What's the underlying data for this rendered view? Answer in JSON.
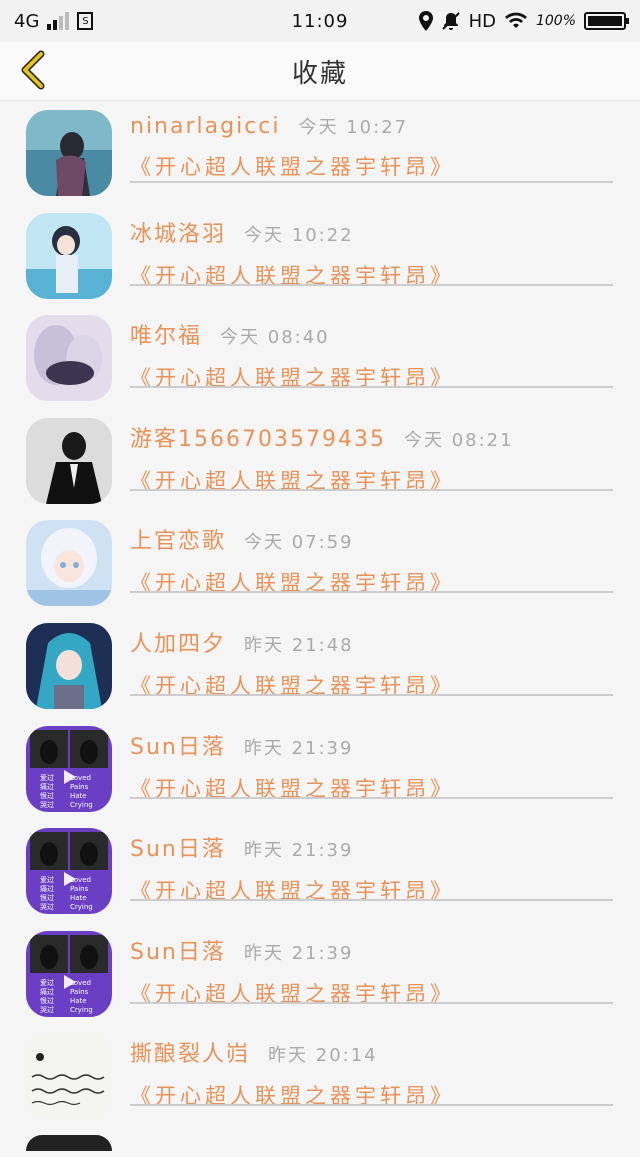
{
  "statusbar": {
    "network": "4G",
    "time": "11:09",
    "hd": "HD",
    "battery_pct": "100%"
  },
  "header": {
    "title": "收藏",
    "back_icon": "chevron-left-icon"
  },
  "colors": {
    "accent": "#e89258",
    "back_icon": "#e6c21a",
    "divider": "#cccccc"
  },
  "items": [
    {
      "username": "ninarlagicci",
      "time": "今天 10:27",
      "song": "《开心超人联盟之器宇轩昂》",
      "avatar": "avatar-blue-girl"
    },
    {
      "username": "冰城洛羽",
      "time": "今天 10:22",
      "song": "《开心超人联盟之器宇轩昂》",
      "avatar": "avatar-anime-boy-blue"
    },
    {
      "username": "唯尔福",
      "time": "今天 08:40",
      "song": "《开心超人联盟之器宇轩昂》",
      "avatar": "avatar-anime-sleeping"
    },
    {
      "username": "游客1566703579435",
      "time": "今天 08:21",
      "song": "《开心超人联盟之器宇轩昂》",
      "avatar": "avatar-bw-man"
    },
    {
      "username": "上官恋歌",
      "time": "今天 07:59",
      "song": "《开心超人联盟之器宇轩昂》",
      "avatar": "avatar-anime-white-hair"
    },
    {
      "username": "人加四夕",
      "time": "昨天 21:48",
      "song": "《开心超人联盟之器宇轩昂》",
      "avatar": "avatar-miku"
    },
    {
      "username": "Sun日落",
      "time": "昨天 21:39",
      "song": "《开心超人联盟之器宇轩昂》",
      "avatar": "avatar-purple-text"
    },
    {
      "username": "Sun日落",
      "time": "昨天 21:39",
      "song": "《开心超人联盟之器宇轩昂》",
      "avatar": "avatar-purple-text"
    },
    {
      "username": "Sun日落",
      "time": "昨天 21:39",
      "song": "《开心超人联盟之器宇轩昂》",
      "avatar": "avatar-purple-text"
    },
    {
      "username": "撕酿裂人岿",
      "time": "昨天 20:14",
      "song": "《开心超人联盟之器宇轩昂》",
      "avatar": "avatar-handwriting"
    }
  ],
  "purple_avatar_text": {
    "left": [
      "爱过",
      "痛过",
      "恨过",
      "哭过"
    ],
    "right": [
      "Loved",
      "Pains",
      "Hate",
      "Crying"
    ]
  }
}
